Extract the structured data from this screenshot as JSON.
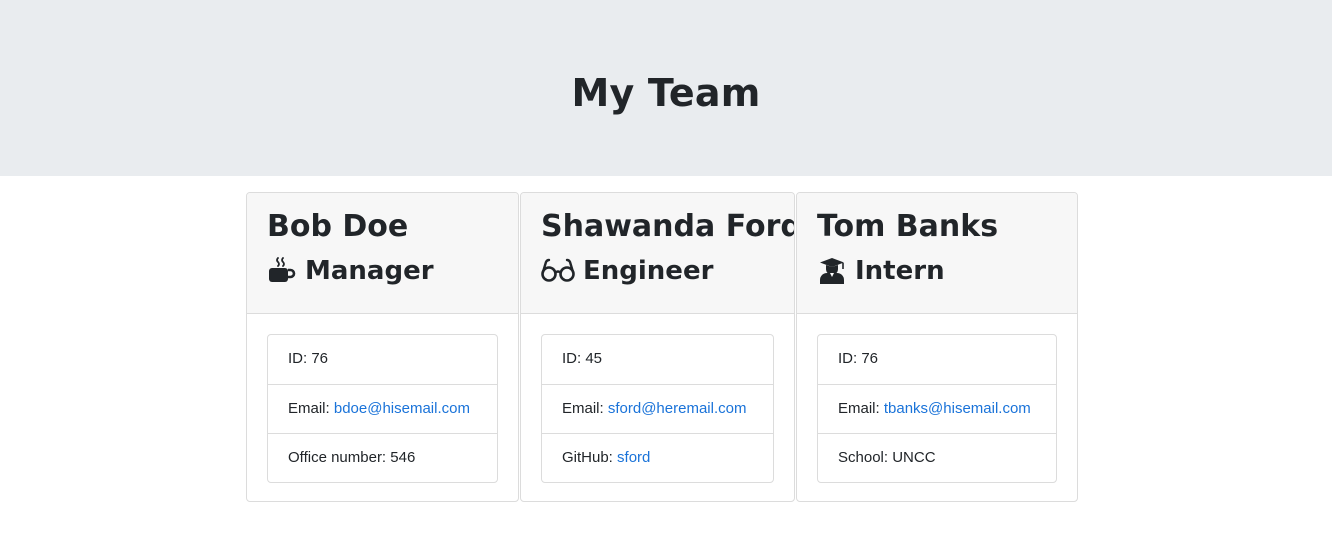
{
  "page": {
    "title": "My Team"
  },
  "team": [
    {
      "name": "Bob Doe",
      "role": "Manager",
      "icon": "coffee-icon",
      "id_label": "ID:",
      "id": "76",
      "email_label": "Email:",
      "email": "bdoe@hisemail.com",
      "extra_label": "Office number:",
      "extra": "546"
    },
    {
      "name": "Shawanda Ford",
      "role": "Engineer",
      "icon": "glasses-icon",
      "id_label": "ID:",
      "id": "45",
      "email_label": "Email:",
      "email": "sford@heremail.com",
      "extra_label": "GitHub:",
      "extra": "sford"
    },
    {
      "name": "Tom Banks",
      "role": "Intern",
      "icon": "graduate-icon",
      "id_label": "ID:",
      "id": "76",
      "email_label": "Email:",
      "email": "tbanks@hisemail.com",
      "extra_label": "School:",
      "extra": "UNCC"
    }
  ],
  "colors": {
    "header_bg": "#e9ecef",
    "link": "#1a73d9",
    "card_header_bg": "#f7f7f7"
  }
}
